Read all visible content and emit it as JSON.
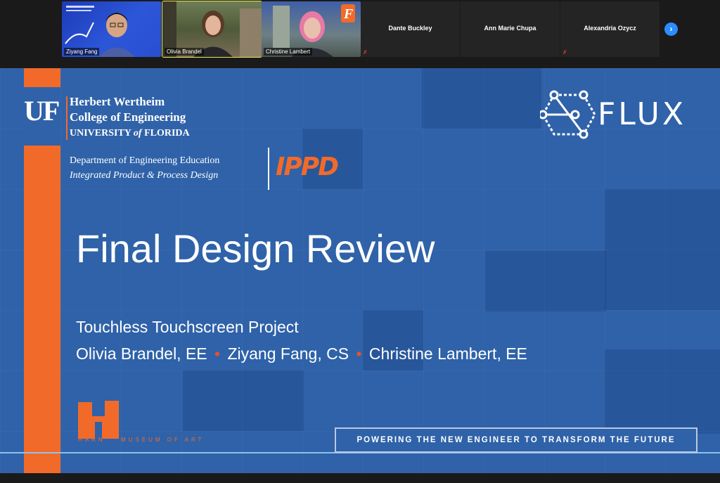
{
  "participants": [
    {
      "name": "Ziyang Fang",
      "has_video": true
    },
    {
      "name": "Olivia Brandel",
      "has_video": true,
      "active": true
    },
    {
      "name": "Christine Lambert",
      "has_video": true
    },
    {
      "name": "Dante Buckley",
      "has_video": false
    },
    {
      "name": "Ann Marie Chupa",
      "has_video": false
    },
    {
      "name": "Alexandria Ozycz",
      "has_video": false
    }
  ],
  "next_page_icon": "chevron-right-icon",
  "slide": {
    "uf_mark": "UF",
    "college_line1": "Herbert Wertheim",
    "college_line2": "College of Engineering",
    "university_pre": "UNIVERSITY ",
    "university_of": "of",
    "university_post": " FLORIDA",
    "dept_line1": "Department of Engineering Education",
    "dept_line2": "Integrated Product & Process Design",
    "ippd_logo": "IPPD",
    "flux_logo": "FLUX",
    "title": "Final Design Review",
    "subtitle": "Touchless Touchscreen Project",
    "authors": [
      "Olivia Brandel, EE",
      "Ziyang Fang, CS",
      "Christine Lambert, EE"
    ],
    "author_separator": "•",
    "harn_letters": "HARN",
    "harn_label": "MUSEUM OF ART",
    "tagline": "POWERING THE NEW ENGINEER TO TRANSFORM THE FUTURE"
  },
  "colors": {
    "slide_blue": "#2f62a8",
    "uf_orange": "#f26a2a",
    "zoom_blue": "#2d8cff",
    "active_speaker": "#e8e85a"
  }
}
